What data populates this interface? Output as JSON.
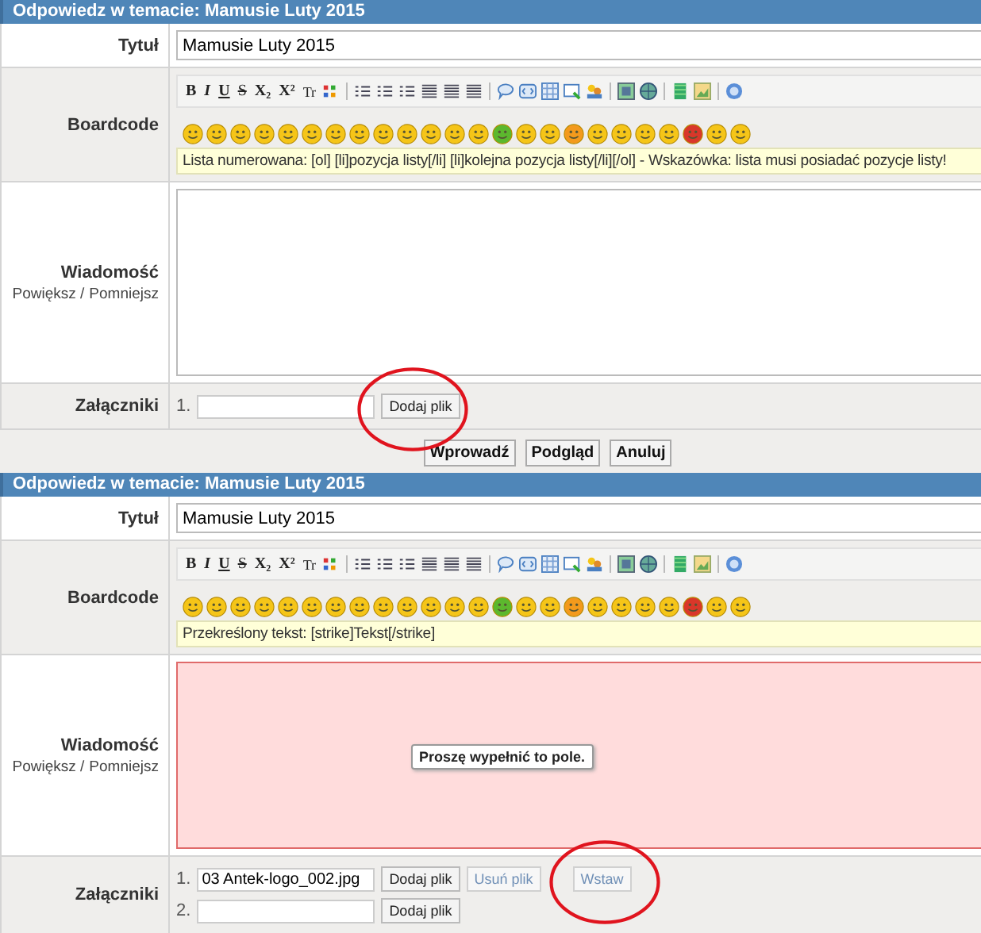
{
  "forms": [
    {
      "header": "Odpowiedz w temacie: Mamusie Luty 2015",
      "title": {
        "label": "Tytuł",
        "value": "Mamusie Luty 2015"
      },
      "boardcode": {
        "label": "Boardcode",
        "toolbar": [
          "B",
          "I",
          "U",
          "S",
          "X₂",
          "X²",
          "Tr"
        ],
        "hint": "Lista numerowana: [ol] [li]pozycja listy[/li] [li]kolejna pozycja listy[/li][/ol] - Wskazówka: lista musi posiadać pozycje listy!"
      },
      "message": {
        "label": "Wiadomość",
        "links": [
          "Powiększ /",
          "Pomniejsz"
        ],
        "invalid": false
      },
      "attachments": {
        "label": "Załączniki",
        "items": [
          {
            "number": "1.",
            "value": "",
            "buttons": [
              {
                "label": "Dodaj plik",
                "disabled": false,
                "circled": true
              }
            ]
          }
        ]
      },
      "actions": [
        "Wprowadź",
        "Podgląd",
        "Anuluj"
      ]
    },
    {
      "header": "Odpowiedz w temacie: Mamusie Luty 2015",
      "title": {
        "label": "Tytuł",
        "value": "Mamusie Luty 2015"
      },
      "boardcode": {
        "label": "Boardcode",
        "toolbar": [
          "B",
          "I",
          "U",
          "S",
          "X₂",
          "X²",
          "Tr"
        ],
        "hint": "Przekreślony tekst: [strike]Tekst[/strike]"
      },
      "message": {
        "label": "Wiadomość",
        "links": [
          "Powiększ /",
          "Pomniejsz"
        ],
        "invalid": true,
        "tooltip": "Proszę wypełnić to pole."
      },
      "attachments": {
        "label": "Załączniki",
        "items": [
          {
            "number": "1.",
            "value": "03 Antek-logo_002.jpg",
            "buttons": [
              {
                "label": "Dodaj plik",
                "disabled": false,
                "circled": false
              },
              {
                "label": "Usuń plik",
                "disabled": true,
                "circled": false
              },
              {
                "label": "Wstaw",
                "disabled": true,
                "circled": true
              }
            ]
          },
          {
            "number": "2.",
            "value": "",
            "buttons": [
              {
                "label": "Dodaj plik",
                "disabled": false,
                "circled": false
              }
            ]
          }
        ]
      }
    }
  ],
  "smileys": [
    {
      "color": "#f5c518"
    },
    {
      "color": "#f5c518"
    },
    {
      "color": "#f5c518"
    },
    {
      "color": "#f5c518"
    },
    {
      "color": "#f5c518"
    },
    {
      "color": "#f5c518"
    },
    {
      "color": "#f5c518"
    },
    {
      "color": "#f5c518"
    },
    {
      "color": "#f5c518"
    },
    {
      "color": "#f5c518"
    },
    {
      "color": "#f5c518"
    },
    {
      "color": "#f5c518"
    },
    {
      "color": "#f5c518"
    },
    {
      "color": "#5cb82e"
    },
    {
      "color": "#f5c518"
    },
    {
      "color": "#f5c518"
    },
    {
      "color": "#f39a1c"
    },
    {
      "color": "#f5c518"
    },
    {
      "color": "#f5c518"
    },
    {
      "color": "#f5c518"
    },
    {
      "color": "#f5c518"
    },
    {
      "color": "#d9372a"
    },
    {
      "color": "#f5c518"
    },
    {
      "color": "#f5c518"
    }
  ]
}
